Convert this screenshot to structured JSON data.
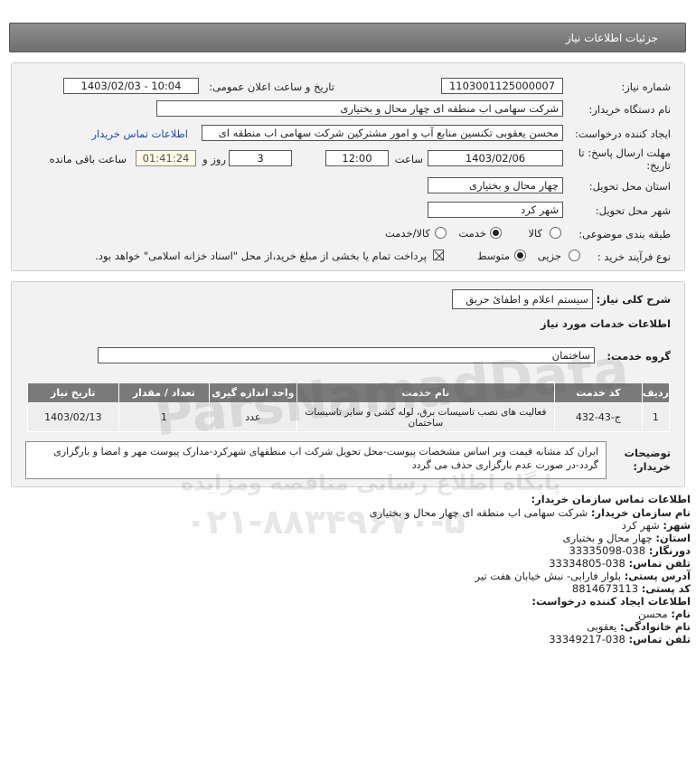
{
  "header": {
    "title": "جزئیات اطلاعات نیاز"
  },
  "form": {
    "need_number_label": "شماره نیاز:",
    "need_number": "1103001125000007",
    "announce_label": "تاریخ و ساعت اعلان عمومی:",
    "announce_value": "1403/02/03 - 10:04",
    "buyer_org_label": "نام دستگاه خریدار:",
    "buyer_org": "شرکت سهامی اب منطقه ای چهار محال و بختیاری",
    "creator_label": "ایجاد کننده درخواست:",
    "creator": "محسن یعقوبی تکنسین منابع آب و امور مشترکین شرکت سهامی اب منطقه ای",
    "contact_link": "اطلاعات تماس خریدار",
    "deadline_label": "مهلت ارسال پاسخ: تا تاریخ:",
    "deadline_date": "1403/02/06",
    "time_label": "ساعت",
    "deadline_time": "12:00",
    "day_label": "روز و",
    "days": "3",
    "remaining": "01:41:24",
    "remaining_label": "ساعت باقی مانده",
    "province_label": "استان محل تحویل:",
    "province": "چهار محال و بختیاری",
    "city_label": "شهر محل تحویل:",
    "city": "شهر کرد",
    "category_label": "طبقه بندی موضوعی:",
    "category_options": [
      "کالا",
      "خدمت",
      "کالا/خدمت"
    ],
    "category_selected": "خدمت",
    "process_label": "نوع فرآیند خرید :",
    "process_options": [
      "جزیی",
      "متوسط"
    ],
    "process_selected": "متوسط",
    "payment_note": "پرداخت تمام یا بخشی از مبلغ خرید،از محل \"اسناد خزانه اسلامی\" خواهد بود.",
    "payment_checked": true
  },
  "summary": {
    "general_desc_label": "شرح کلی نیاز:",
    "general_desc": "سیستم اعلام و اطفائ حریق",
    "services_heading": "اطلاعات خدمات مورد نیاز",
    "group_label": "گروه خدمت:",
    "group_value": "ساختمان",
    "table": {
      "headers": [
        "ردیف",
        "کد خدمت",
        "نام خدمت",
        "واحد اندازه گیری",
        "تعداد / مقدار",
        "تاریخ نیاز"
      ],
      "rows": [
        [
          "1",
          "ج-43-432",
          "فعالیت های نصب تاسیسات برق، لوله کشی و سایر تاسیسات ساختمان",
          "عدد",
          "1",
          "1403/02/13"
        ]
      ]
    },
    "buyer_notes_label": "توضیحات خریدار:",
    "buyer_notes": "ایران کد مشابه قیمت وبر اساس مشخصات پیوست-محل تحویل شرکت اب منطقهای شهرکرد-مدارک پیوست مهر و امضا و بارگزاری گردد-در صورت عدم بارگزاری حذف می گردد"
  },
  "contact": {
    "section_title": "اطلاعات تماس سازمان خریدار:",
    "org_name_label": "نام سازمان خریدار:",
    "org_name": "شرکت سهامی اب منطقه ای چهار محال و بختیاری",
    "city_label": "شهر:",
    "city": "شهر کرد",
    "province_label": "استان:",
    "province": "چهار محال و بختیاری",
    "fax_label": "دورنگار:",
    "fax": "038-33335098",
    "phone_label": "تلفن تماس:",
    "phone": "038-33334805",
    "address_label": "آدرس پستی:",
    "address": "بلوار فارابی- نبش خیابان هفت تیر",
    "postal_label": "کد پستی:",
    "postal": "8814673113",
    "creator_title": "اطلاعات ایجاد کننده درخواست:",
    "first_name_label": "نام:",
    "first_name": "محسن",
    "last_name_label": "نام خانوادگی:",
    "last_name": "یعقوبی",
    "creator_phone_label": "تلفن تماس:",
    "creator_phone": "038-33349217"
  },
  "watermark": {
    "site": "ParsNamadData",
    "tagline": "پایگاه اطلاع رسانی مناقصه ومزایده",
    "phone": "۰۲۱-۸۸۳۴۹۶۷۰-۵"
  }
}
